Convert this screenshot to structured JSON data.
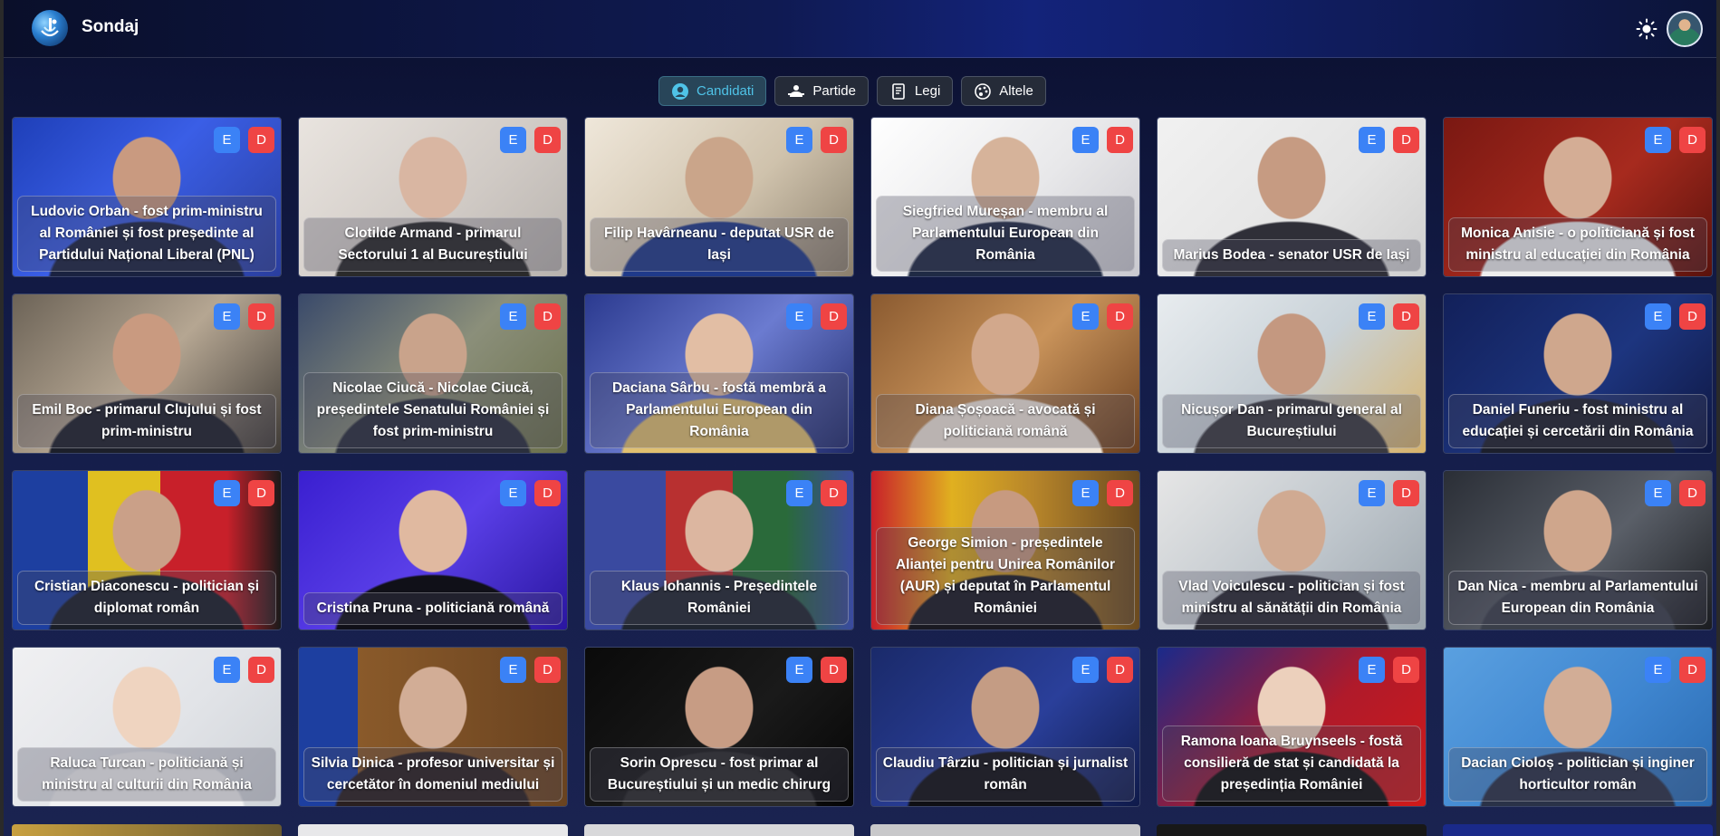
{
  "app": {
    "title": "Sondaj",
    "logo_icon": "sondaj-logo-icon",
    "theme_icon": "sun-icon"
  },
  "tabs": [
    {
      "label": "Candidati",
      "icon": "user-circle-icon",
      "active": true
    },
    {
      "label": "Partide",
      "icon": "party-group-icon",
      "active": false
    },
    {
      "label": "Legi",
      "icon": "law-document-icon",
      "active": false
    },
    {
      "label": "Altele",
      "icon": "palette-icon",
      "active": false
    }
  ],
  "buttons": {
    "e": "E",
    "d": "D"
  },
  "colors": {
    "e_button": "#3b82f6",
    "d_button": "#ef4444",
    "active_tab": "#4fc3e8"
  },
  "candidates": [
    {
      "text": "Ludovic Orban - fost prim-ministru al României și fost președinte al Partidului Național Liberal (PNL)",
      "bg": "linear-gradient(135deg,#1e3fb8 0%,#3a5ee6 45%,#2a3e9e 100%)",
      "skin": "#c99a80",
      "suit": "#1a2240"
    },
    {
      "text": "Clotilde Armand - primarul Sectorului 1 al Bucureștiului",
      "bg": "linear-gradient(135deg,#e9e4df 0%,#cfc9c4 60%,#b8b3ae 100%)",
      "skin": "#d9b6a2",
      "suit": "#2a2a2a"
    },
    {
      "text": "Filip Havârneanu - deputat USR de Iași",
      "bg": "linear-gradient(135deg,#efe7da 0%,#cfc2ac 55%,#8b7f6c 100%)",
      "skin": "#caa58a",
      "suit": "#1f3a8a"
    },
    {
      "text": "Siegfried Mureșan - membru al Parlamentului European din România",
      "bg": "linear-gradient(135deg,#ffffff 0%,#e8e8ea 55%,#c9c9cf 100%)",
      "skin": "#d6b39a",
      "suit": "#1f2a44"
    },
    {
      "text": "Marius Bodea - senator USR de Iași",
      "bg": "linear-gradient(135deg,#f1f1f1 0%,#e4e4e4 60%,#cfcfcf 100%)",
      "skin": "#c69b82",
      "suit": "#2f2f38"
    },
    {
      "text": "Monica Anisie - o politiciană și fost ministru al educației din România",
      "bg": "linear-gradient(135deg,#7a1812 0%,#a72a1e 55%,#5a120c 100%)",
      "skin": "#d4ad95",
      "suit": "#eeeeee"
    },
    {
      "text": "Emil Boc - primarul Clujului și fost prim-ministru",
      "bg": "linear-gradient(135deg,#6c6357 0%,#b5a692 50%,#3e3a36 100%)",
      "skin": "#c99a80",
      "suit": "#1c1f2a"
    },
    {
      "text": "Nicolae Ciucă - Nicolae Ciucă, președintele Senatului României și fost prim-ministru",
      "bg": "linear-gradient(135deg,#3a4a6a 0%,#8b8f7a 50%,#6a6f4a 100%)",
      "skin": "#c9a38b",
      "suit": "#2a2f3d"
    },
    {
      "text": "Daciana Sârbu - fostă membră a Parlamentului European din România",
      "bg": "linear-gradient(135deg,#2b3a8f 0%,#6b7bd0 50%,#1f2a6a 100%)",
      "skin": "#e2bea4",
      "suit": "#e0c070"
    },
    {
      "text": "Diana Șoșoacă - avocată și politiciană română",
      "bg": "linear-gradient(135deg,#8a5a30 0%,#c9935a 50%,#6a3f1f 100%)",
      "skin": "#d2a88c",
      "suit": "#f0e6da"
    },
    {
      "text": "Nicușor Dan - primarul general al Bucureștiului",
      "bg": "linear-gradient(135deg,#e8ecef 0%,#c9d2d8 50%,#d8b36a 100%)",
      "skin": "#c49880",
      "suit": "#3a3a40"
    },
    {
      "text": "Daniel Funeriu - fost ministru al educației și cercetării din România",
      "bg": "linear-gradient(135deg,#12205a 0%,#1d357f 55%,#0e1640 100%)",
      "skin": "#cfa78d",
      "suit": "#1c1f2c"
    },
    {
      "text": "Cristian Diaconescu - politician și diplomat român",
      "bg": "linear-gradient(90deg,#1d3fa0 0%,#1d3fa0 28%,#e0c020 28%,#e0c020 55%,#c8202a 55%,#c8202a 80%,#1a1a1a 100%)",
      "skin": "#caa088",
      "suit": "#1a1e28"
    },
    {
      "text": "Cristina Pruna - politiciană română",
      "bg": "linear-gradient(135deg,#3a1fd0 0%,#5a3fe8 50%,#2a16a0 100%)",
      "skin": "#e0b9a0",
      "suit": "#101018"
    },
    {
      "text": "Klaus Iohannis - Președintele României",
      "bg": "linear-gradient(90deg,#3a4aa0 0%,#3a4aa0 30%,#b83030 30%,#b83030 55%,#2a6a3a 55%,#2a6a3a 75%,#3a4aa0 100%)",
      "skin": "#dcb6a0",
      "suit": "#1f2530"
    },
    {
      "text": "George Simion - președintele Alianței pentru Unirea Românilor (AUR) și deputat în Parlamentul României",
      "bg": "linear-gradient(90deg,#c8202a 0%,#e0b020 30%,#b8862a 60%,#6a4a20 100%)",
      "skin": "#c79a80",
      "suit": "#1a1a22"
    },
    {
      "text": "Vlad Voiculescu - politician și fost ministru al sănătății din România",
      "bg": "linear-gradient(135deg,#e6e6e6 0%,#bfc6cc 55%,#9aa4ac 100%)",
      "skin": "#d0aa92",
      "suit": "#2a2a33"
    },
    {
      "text": "Dan Nica - membru al Parlamentului European din România",
      "bg": "linear-gradient(135deg,#2a2e36 0%,#5a5f68 55%,#1a1c20 100%)",
      "skin": "#cfa68c",
      "suit": "#3a3f4a"
    },
    {
      "text": "Raluca Turcan - politiciană și ministru al culturii din România",
      "bg": "linear-gradient(135deg,#f0f0f2 0%,#e2e4e8 55%,#cfd3d8 100%)",
      "skin": "#efd4c0",
      "suit": "#f2f2f2"
    },
    {
      "text": "Silvia Dinica - profesor universitar și cercetător în domeniul mediului",
      "bg": "linear-gradient(90deg,#1d3fa0 0%,#1d3fa0 22%,#8a5a2a 22%,#6a4320 100%)",
      "skin": "#d2ad96",
      "suit": "#2a2020"
    },
    {
      "text": "Sorin Oprescu - fost primar al Bucureștiului și un medic chirurg",
      "bg": "linear-gradient(135deg,#0a0a0a 0%,#1a1a1a 55%,#050505 100%)",
      "skin": "#c79c84",
      "suit": "#2a2a2a"
    },
    {
      "text": "Claudiu Târziu - politician și jurnalist român",
      "bg": "linear-gradient(135deg,#1a2a6a 0%,#2a3f9a 55%,#0f1a4a 100%)",
      "skin": "#c49c84",
      "suit": "#0f0f14"
    },
    {
      "text": "Ramona Ioana Bruynseels - fostă consilieră de stat și candidată la președinția României",
      "bg": "linear-gradient(135deg,#1a2a8a 0%,#b01a2a 55%,#d01a1a 100%)",
      "skin": "#ecd0bc",
      "suit": "#101010"
    },
    {
      "text": "Dacian Cioloș - politician și inginer horticultor român",
      "bg": "linear-gradient(135deg,#5aa0e0 0%,#3f86d0 55%,#2a6ab0 100%)",
      "skin": "#d2ad96",
      "suit": "#2a3248"
    }
  ]
}
